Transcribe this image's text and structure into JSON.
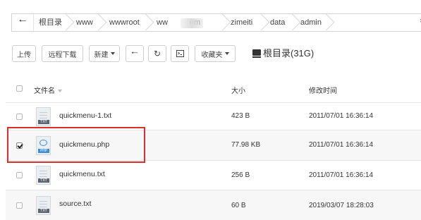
{
  "breadcrumb": {
    "back_icon": "arrow-left-icon",
    "items": [
      "根目录",
      "www",
      "wwwroot",
      "ww",
      "om",
      "zimeiti",
      "data",
      "admin"
    ],
    "refresh_icon": "refresh-icon"
  },
  "toolbar": {
    "upload_label": "上传",
    "remote_download_label": "远程下载",
    "new_label": "新建",
    "back_icon": "arrow-left-icon",
    "refresh_icon": "refresh-icon",
    "terminal_icon": "terminal-icon",
    "favorites_label": "收藏夹",
    "disk_label": "根目录(31G)"
  },
  "table": {
    "columns": {
      "name": "文件名",
      "size": "大小",
      "modified": "修改时间"
    },
    "rows": [
      {
        "name": "quickmenu-1.txt",
        "type": "TXT",
        "size": "423 B",
        "modified": "2011/07/01 16:36:14",
        "checked": false
      },
      {
        "name": "quickmenu.php",
        "type": "PHP",
        "size": "77.98 KB",
        "modified": "2011/07/01 16:36:14",
        "checked": true
      },
      {
        "name": "quickmenu.txt",
        "type": "TXT",
        "size": "256 B",
        "modified": "2011/07/01 16:36:14",
        "checked": false
      },
      {
        "name": "source.txt",
        "type": "TXT",
        "size": "60 B",
        "modified": "2019/03/07 18:28:03",
        "checked": false
      }
    ]
  },
  "colors": {
    "highlight": "#d9302c",
    "php_accent": "#3d8fd8"
  }
}
